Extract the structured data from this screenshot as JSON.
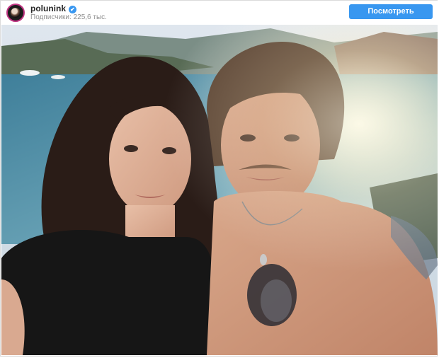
{
  "post": {
    "username": "polunink",
    "verified_badge": "✔",
    "followers_text": "Подписчики: 225,6 тыс.",
    "view_profile_label": "Посмотреть профиль",
    "accent_color": "#3897f0"
  },
  "photo": {
    "subject": "selfie-photo",
    "icons": [
      "verified-icon",
      "avatar"
    ]
  }
}
